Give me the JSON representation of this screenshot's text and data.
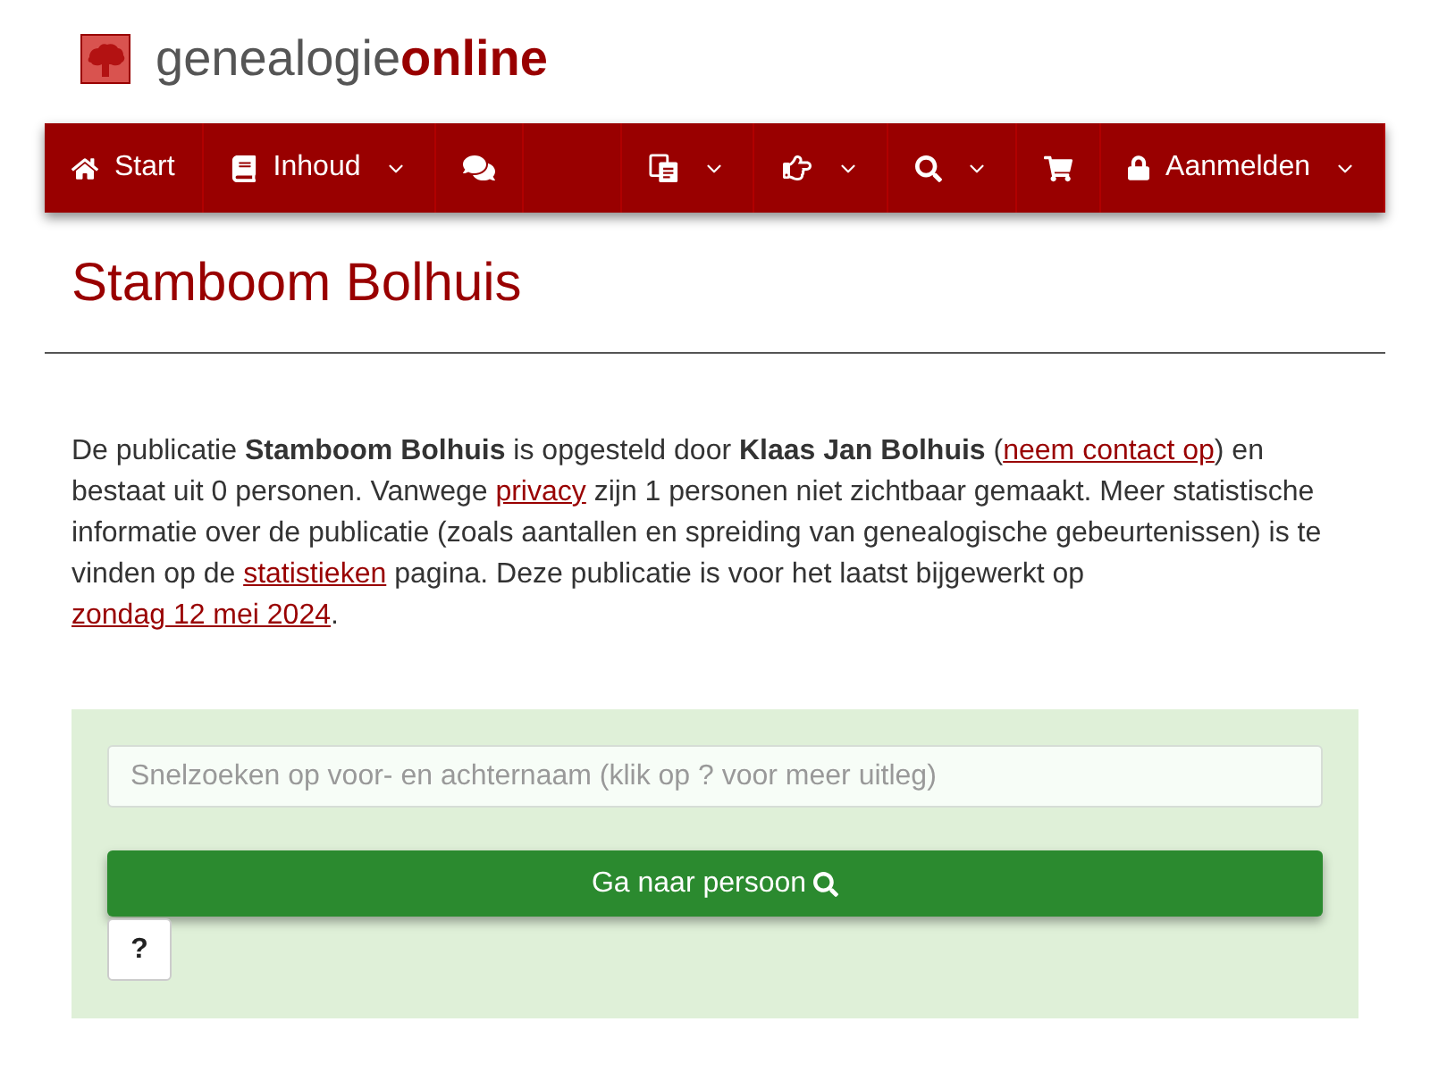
{
  "logo": {
    "name": "genealogie",
    "highlight": "online"
  },
  "nav": {
    "left": [
      {
        "label": "Start",
        "dropdown": false
      },
      {
        "label": "Inhoud",
        "dropdown": true
      },
      {
        "dropdown": false
      }
    ],
    "right": [
      {
        "dropdown": true
      },
      {
        "dropdown": true
      },
      {
        "dropdown": true
      },
      {
        "dropdown": false
      },
      {
        "label": "Aanmelden",
        "dropdown": true
      }
    ]
  },
  "page_title": "Stamboom Bolhuis",
  "intro": [
    {
      "kind": "text",
      "text": "De publicatie **Stamboom Bolhuis** is opgesteld door **Klaas Jan Bolhuis** ("
    },
    {
      "kind": "link",
      "text": "neem contact op"
    },
    {
      "kind": "text",
      "text": ") en bestaat uit 0 personen. Vanwege "
    },
    {
      "kind": "link",
      "text": "privacy"
    },
    {
      "kind": "text",
      "text": " zijn 1 personen niet zichtbaar gemaakt. Meer statistische informatie over de publicatie (zoals aantallen en spreiding van genealogische gebeurtenissen) is te vinden op de "
    },
    {
      "kind": "link",
      "text": "statistieken"
    },
    {
      "kind": "text",
      "text": " pagina. Deze publicatie is voor het laatst bijgewerkt op "
    },
    {
      "kind": "link",
      "text": "zondag 12 mei 2024"
    },
    {
      "kind": "text",
      "text": "."
    }
  ],
  "search": {
    "placeholder": "Snelzoeken op voor- en achternaam (klik op ? voor meer uitleg)",
    "submit": "Ga naar persoon",
    "help": "?"
  }
}
